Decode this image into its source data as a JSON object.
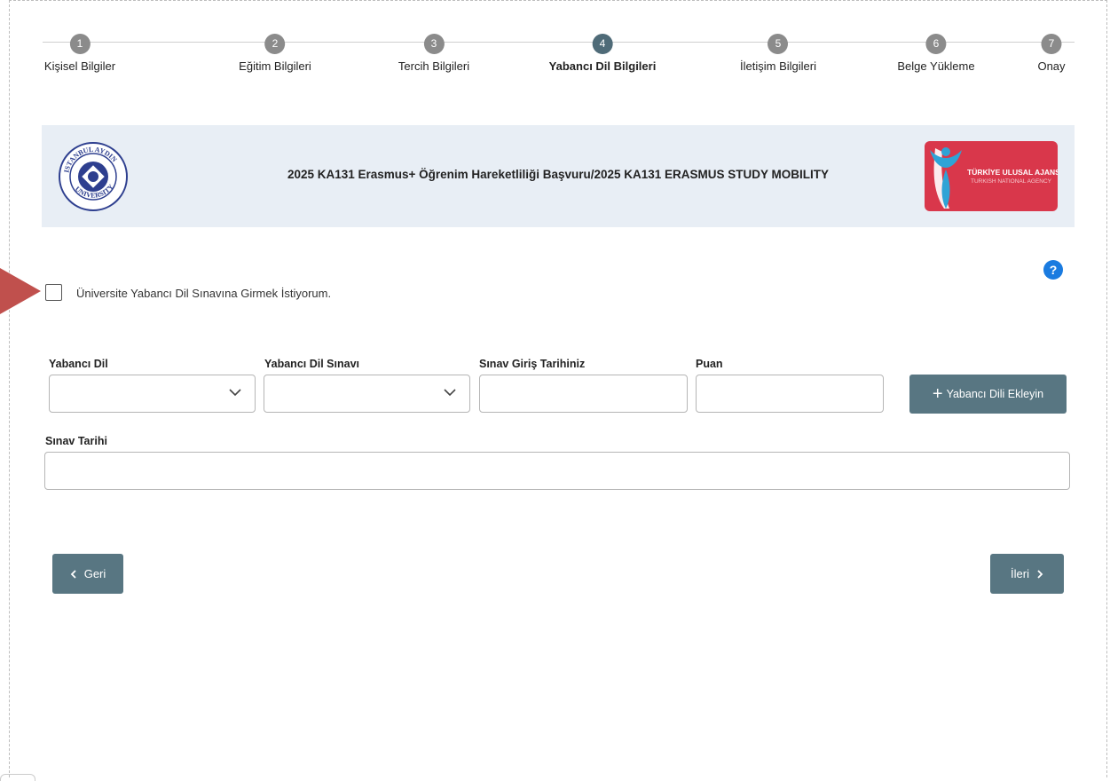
{
  "stepper": {
    "steps": [
      {
        "num": "1",
        "label": "Kişisel Bilgiler"
      },
      {
        "num": "2",
        "label": "Eğitim Bilgileri"
      },
      {
        "num": "3",
        "label": "Tercih Bilgileri"
      },
      {
        "num": "4",
        "label": "Yabancı Dil Bilgileri"
      },
      {
        "num": "5",
        "label": "İletişim Bilgileri"
      },
      {
        "num": "6",
        "label": "Belge Yükleme"
      },
      {
        "num": "7",
        "label": "Onay"
      }
    ],
    "active_step": "4"
  },
  "banner": {
    "title": "2025 KA131 Erasmus+ Öğrenim Hareketliliği Başvuru/2025 KA131 ERASMUS STUDY MOBILITY",
    "left_logo_text": "İSTANBUL AYDIN UNIVERSITY",
    "right_logo_line1": "TÜRKİYE ULUSAL AJANSI",
    "right_logo_line2": "TURKISH NATIONAL AGENCY"
  },
  "help": {
    "icon": "question-circle-icon",
    "glyph": "?"
  },
  "exam_checkbox": {
    "label": "Üniversite Yabancı Dil Sınavına Girmek İstiyorum.",
    "checked": false
  },
  "form": {
    "language_label": "Yabancı Dil",
    "language_value": "",
    "exam_label": "Yabancı Dil Sınavı",
    "exam_value": "",
    "entry_date_label": "Sınav Giriş Tarihiniz",
    "entry_date_value": "",
    "score_label": "Puan",
    "score_value": "",
    "add_button_label": "Yabancı Dili Ekleyin",
    "exam_date_label": "Sınav Tarihi",
    "exam_date_value": ""
  },
  "nav": {
    "back_label": "Geri",
    "next_label": "İleri"
  },
  "colors": {
    "accent": "#587682",
    "active_step": "#4f6b78",
    "inactive_step": "#8b8b8b",
    "banner_bg": "#e8eef5",
    "help": "#1a7be0",
    "arrow": "#c0504d"
  }
}
